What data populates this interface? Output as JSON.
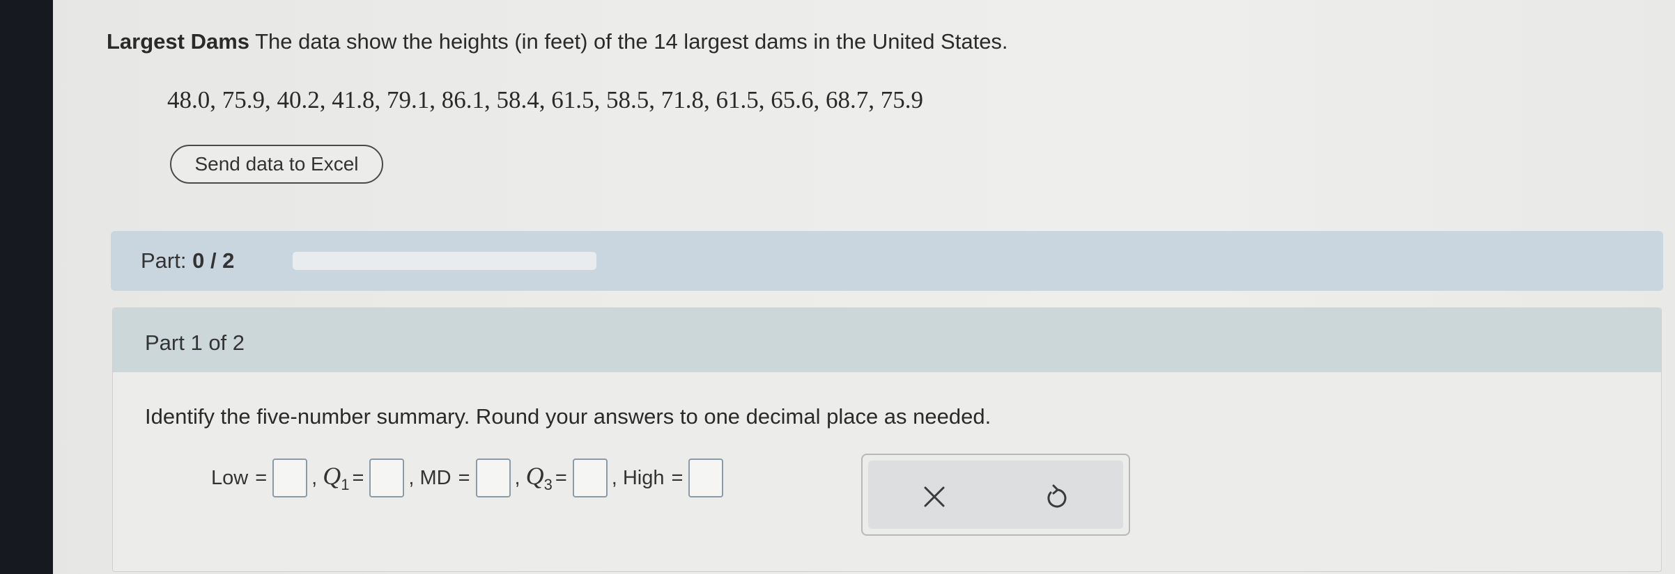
{
  "problem": {
    "title_bold": "Largest Dams",
    "title_text": " The data show the heights (in feet) of the 14 largest dams in the United States.",
    "data_values": "48.0, 75.9, 40.2, 41.8, 79.1, 86.1, 58.4, 61.5, 58.5, 71.8, 61.5, 65.6, 68.7, 75.9",
    "excel_button_label": "Send data to Excel"
  },
  "progress": {
    "label": "Part: ",
    "value_text": "0 / 2",
    "fraction": 0
  },
  "part": {
    "header": "Part 1 of 2",
    "instruction": "Identify the five-number summary. Round your answers to one decimal place as needed."
  },
  "answers": {
    "low_label": "Low",
    "q1_label": "Q",
    "q1_sub": "1",
    "md_label": "MD",
    "q3_label": "Q",
    "q3_sub": "3",
    "high_label": "High",
    "equals": "=",
    "comma": ","
  },
  "actions": {
    "clear_icon": "close-icon",
    "undo_icon": "undo-icon"
  },
  "colors": {
    "part_bar": "#c9d6df",
    "part_header": "#ccd7d9",
    "input_border": "#8a9aa6"
  }
}
